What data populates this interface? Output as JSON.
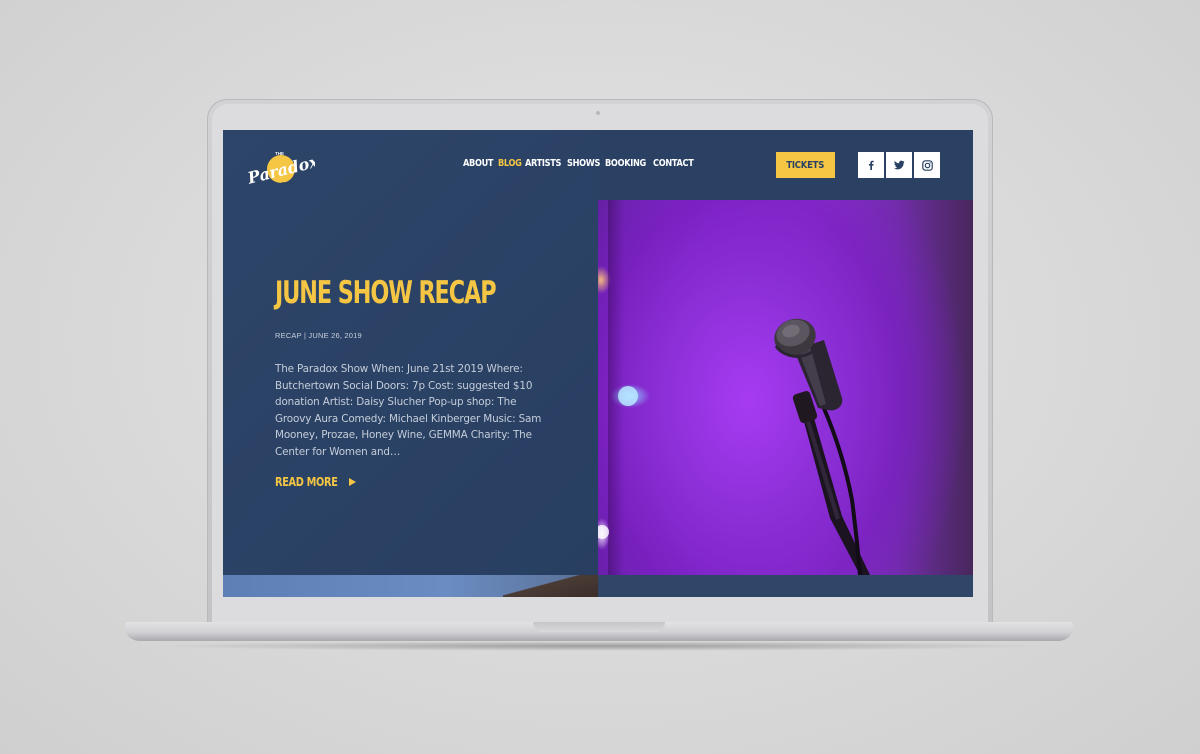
{
  "brand": {
    "logo_lines": [
      "THE",
      "Paradox",
      "SHOW"
    ],
    "colors": {
      "navy": "#2a4164",
      "yellow": "#f5c643",
      "white": "#ffffff"
    }
  },
  "nav": {
    "items": [
      {
        "label": "ABOUT",
        "active": false
      },
      {
        "label": "BLOG",
        "active": true
      },
      {
        "label": "ARTISTS",
        "active": false
      },
      {
        "label": "SHOWS",
        "active": false
      },
      {
        "label": "BOOKING",
        "active": false
      },
      {
        "label": "CONTACT",
        "active": false
      }
    ],
    "tickets_label": "TICKETS",
    "social_icons": [
      "facebook-icon",
      "twitter-icon",
      "instagram-icon"
    ]
  },
  "post": {
    "title": "JUNE SHOW RECAP",
    "meta": "RECAP | JUNE 26, 2019",
    "excerpt": "The Paradox Show When: June 21st 2019 Where: Butchertown Social Doors: 7p Cost: suggested $10 donation Artist: Daisy Slucher Pop-up shop: The Groovy Aura Comedy: Michael Kinberger Music: Sam Mooney, Prozae, Honey Wine, GEMMA Charity: The Center for Women and…",
    "read_more_label": "READ MORE",
    "image_subject": "microphone-on-stand"
  }
}
